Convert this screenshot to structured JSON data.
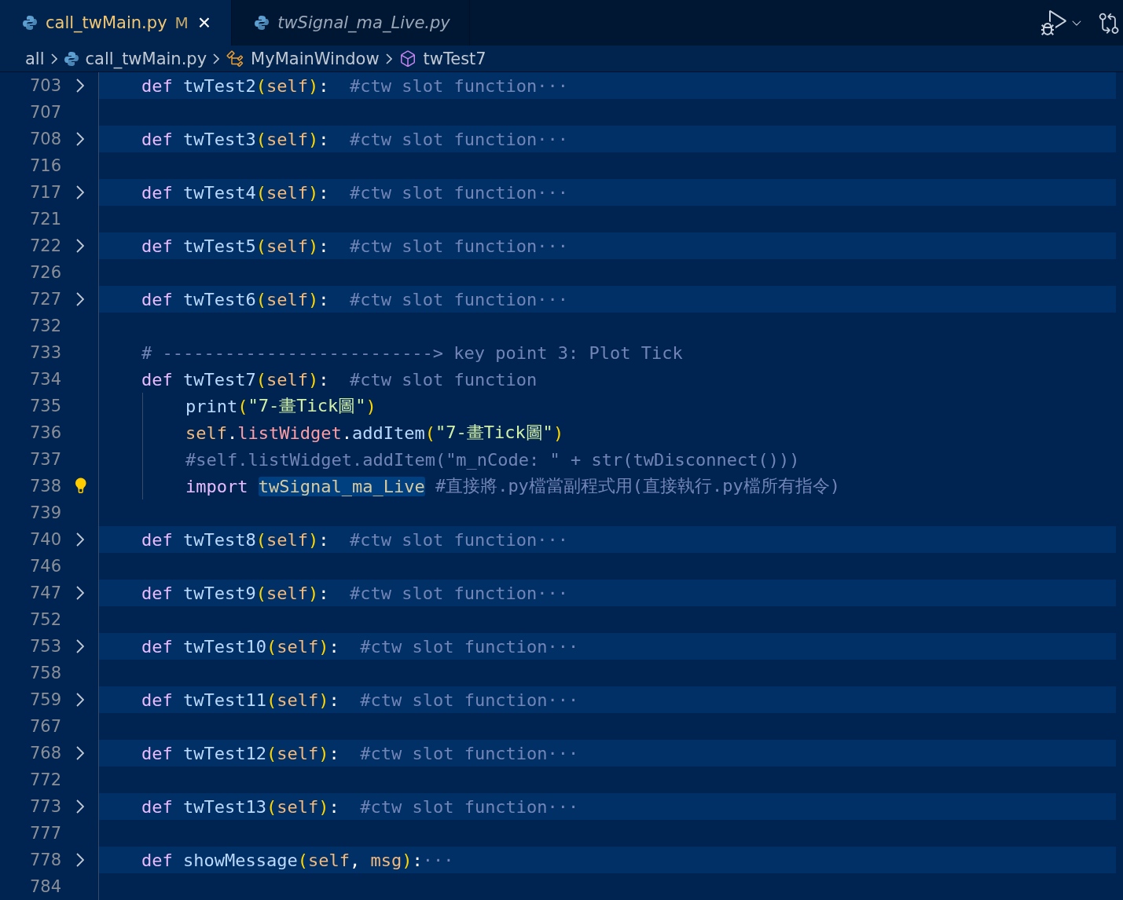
{
  "tabs": [
    {
      "label": "call_twMain.py",
      "selected": true,
      "modified": "M",
      "close": "×",
      "preview": false
    },
    {
      "label": "twSignal_ma_Live.py",
      "selected": false,
      "preview": true
    }
  ],
  "breadcrumbs": [
    {
      "kind": "folder",
      "label": "all"
    },
    {
      "kind": "file",
      "label": "call_twMain.py"
    },
    {
      "kind": "class",
      "label": "MyMainWindow"
    },
    {
      "kind": "method",
      "label": "twTest7"
    }
  ],
  "editor": {
    "lines": [
      {
        "number": "703",
        "folded": true,
        "tokens": [
          {
            "kind": "kw",
            "text": "def "
          },
          {
            "kind": "fn",
            "text": "twTest2"
          },
          {
            "kind": "paren",
            "text": "("
          },
          {
            "kind": "self",
            "text": "self"
          },
          {
            "kind": "paren",
            "text": ")"
          },
          {
            "kind": "plain",
            "text": ":  "
          },
          {
            "kind": "comment",
            "text": "#ctw slot function"
          },
          {
            "kind": "fold",
            "text": "···"
          }
        ]
      },
      {
        "number": "707",
        "folded": false
      },
      {
        "number": "708",
        "folded": true,
        "tokens": [
          {
            "kind": "kw",
            "text": "def "
          },
          {
            "kind": "fn",
            "text": "twTest3"
          },
          {
            "kind": "paren",
            "text": "("
          },
          {
            "kind": "self",
            "text": "self"
          },
          {
            "kind": "paren",
            "text": ")"
          },
          {
            "kind": "plain",
            "text": ":  "
          },
          {
            "kind": "comment",
            "text": "#ctw slot function"
          },
          {
            "kind": "fold",
            "text": "···"
          }
        ]
      },
      {
        "number": "716",
        "folded": false
      },
      {
        "number": "717",
        "folded": true,
        "tokens": [
          {
            "kind": "kw",
            "text": "def "
          },
          {
            "kind": "fn",
            "text": "twTest4"
          },
          {
            "kind": "paren",
            "text": "("
          },
          {
            "kind": "self",
            "text": "self"
          },
          {
            "kind": "paren",
            "text": ")"
          },
          {
            "kind": "plain",
            "text": ":  "
          },
          {
            "kind": "comment",
            "text": "#ctw slot function"
          },
          {
            "kind": "fold",
            "text": "···"
          }
        ]
      },
      {
        "number": "721",
        "folded": false
      },
      {
        "number": "722",
        "folded": true,
        "tokens": [
          {
            "kind": "kw",
            "text": "def "
          },
          {
            "kind": "fn",
            "text": "twTest5"
          },
          {
            "kind": "paren",
            "text": "("
          },
          {
            "kind": "self",
            "text": "self"
          },
          {
            "kind": "paren",
            "text": ")"
          },
          {
            "kind": "plain",
            "text": ":  "
          },
          {
            "kind": "comment",
            "text": "#ctw slot function"
          },
          {
            "kind": "fold",
            "text": "···"
          }
        ]
      },
      {
        "number": "726",
        "folded": false
      },
      {
        "number": "727",
        "folded": true,
        "tokens": [
          {
            "kind": "kw",
            "text": "def "
          },
          {
            "kind": "fn",
            "text": "twTest6"
          },
          {
            "kind": "paren",
            "text": "("
          },
          {
            "kind": "self",
            "text": "self"
          },
          {
            "kind": "paren",
            "text": ")"
          },
          {
            "kind": "plain",
            "text": ":  "
          },
          {
            "kind": "comment",
            "text": "#ctw slot function"
          },
          {
            "kind": "fold",
            "text": "···"
          }
        ]
      },
      {
        "number": "732",
        "folded": false
      },
      {
        "number": "733",
        "folded": false,
        "tokens": [
          {
            "kind": "comment",
            "text": "# --------------------------> key point 3: Plot Tick"
          }
        ]
      },
      {
        "number": "734",
        "folded": false,
        "tokens": [
          {
            "kind": "kw",
            "text": "def "
          },
          {
            "kind": "fn",
            "text": "twTest7"
          },
          {
            "kind": "paren",
            "text": "("
          },
          {
            "kind": "self",
            "text": "self"
          },
          {
            "kind": "paren",
            "text": ")"
          },
          {
            "kind": "plain",
            "text": ":  "
          },
          {
            "kind": "comment",
            "text": "#ctw slot function"
          }
        ]
      },
      {
        "number": "735",
        "folded": false,
        "body": true,
        "tokens": [
          {
            "kind": "fn",
            "text": "print"
          },
          {
            "kind": "paren",
            "text": "("
          },
          {
            "kind": "string",
            "text": "\"7-畫Tick圖\""
          },
          {
            "kind": "paren",
            "text": ")"
          }
        ]
      },
      {
        "number": "736",
        "folded": false,
        "body": true,
        "tokens": [
          {
            "kind": "self",
            "text": "self"
          },
          {
            "kind": "plain",
            "text": "."
          },
          {
            "kind": "attr",
            "text": "listWidget"
          },
          {
            "kind": "plain",
            "text": "."
          },
          {
            "kind": "fn",
            "text": "addItem"
          },
          {
            "kind": "paren",
            "text": "("
          },
          {
            "kind": "string",
            "text": "\"7-畫Tick圖\""
          },
          {
            "kind": "paren",
            "text": ")"
          }
        ]
      },
      {
        "number": "737",
        "folded": false,
        "body": true,
        "tokens": [
          {
            "kind": "comment",
            "text": "#self.listWidget.addItem(\"m_nCode: \" + str(twDisconnect()))"
          }
        ]
      },
      {
        "number": "738",
        "folded": false,
        "body": true,
        "lightbulb": true,
        "tokens": [
          {
            "kind": "kw",
            "text": "import "
          },
          {
            "kind": "module",
            "text": "twSignal_ma_Live",
            "highlighted": true
          },
          {
            "kind": "comment",
            "text": " #直接將.py檔當副程式用(直接執行.py檔所有指令)"
          }
        ]
      },
      {
        "number": "739",
        "folded": false
      },
      {
        "number": "740",
        "folded": true,
        "tokens": [
          {
            "kind": "kw",
            "text": "def "
          },
          {
            "kind": "fn",
            "text": "twTest8"
          },
          {
            "kind": "paren",
            "text": "("
          },
          {
            "kind": "self",
            "text": "self"
          },
          {
            "kind": "paren",
            "text": ")"
          },
          {
            "kind": "plain",
            "text": ":  "
          },
          {
            "kind": "comment",
            "text": "#ctw slot function"
          },
          {
            "kind": "fold",
            "text": "···"
          }
        ]
      },
      {
        "number": "746",
        "folded": false
      },
      {
        "number": "747",
        "folded": true,
        "tokens": [
          {
            "kind": "kw",
            "text": "def "
          },
          {
            "kind": "fn",
            "text": "twTest9"
          },
          {
            "kind": "paren",
            "text": "("
          },
          {
            "kind": "self",
            "text": "self"
          },
          {
            "kind": "paren",
            "text": ")"
          },
          {
            "kind": "plain",
            "text": ":  "
          },
          {
            "kind": "comment",
            "text": "#ctw slot function"
          },
          {
            "kind": "fold",
            "text": "···"
          }
        ]
      },
      {
        "number": "752",
        "folded": false
      },
      {
        "number": "753",
        "folded": true,
        "tokens": [
          {
            "kind": "kw",
            "text": "def "
          },
          {
            "kind": "fn",
            "text": "twTest10"
          },
          {
            "kind": "paren",
            "text": "("
          },
          {
            "kind": "self",
            "text": "self"
          },
          {
            "kind": "paren",
            "text": ")"
          },
          {
            "kind": "plain",
            "text": ":  "
          },
          {
            "kind": "comment",
            "text": "#ctw slot function"
          },
          {
            "kind": "fold",
            "text": "···"
          }
        ]
      },
      {
        "number": "758",
        "folded": false
      },
      {
        "number": "759",
        "folded": true,
        "tokens": [
          {
            "kind": "kw",
            "text": "def "
          },
          {
            "kind": "fn",
            "text": "twTest11"
          },
          {
            "kind": "paren",
            "text": "("
          },
          {
            "kind": "self",
            "text": "self"
          },
          {
            "kind": "paren",
            "text": ")"
          },
          {
            "kind": "plain",
            "text": ":  "
          },
          {
            "kind": "comment",
            "text": "#ctw slot function"
          },
          {
            "kind": "fold",
            "text": "···"
          }
        ]
      },
      {
        "number": "767",
        "folded": false
      },
      {
        "number": "768",
        "folded": true,
        "tokens": [
          {
            "kind": "kw",
            "text": "def "
          },
          {
            "kind": "fn",
            "text": "twTest12"
          },
          {
            "kind": "paren",
            "text": "("
          },
          {
            "kind": "self",
            "text": "self"
          },
          {
            "kind": "paren",
            "text": ")"
          },
          {
            "kind": "plain",
            "text": ":  "
          },
          {
            "kind": "comment",
            "text": "#ctw slot function"
          },
          {
            "kind": "fold",
            "text": "···"
          }
        ]
      },
      {
        "number": "772",
        "folded": false
      },
      {
        "number": "773",
        "folded": true,
        "tokens": [
          {
            "kind": "kw",
            "text": "def "
          },
          {
            "kind": "fn",
            "text": "twTest13"
          },
          {
            "kind": "paren",
            "text": "("
          },
          {
            "kind": "self",
            "text": "self"
          },
          {
            "kind": "paren",
            "text": ")"
          },
          {
            "kind": "plain",
            "text": ":  "
          },
          {
            "kind": "comment",
            "text": "#ctw slot function"
          },
          {
            "kind": "fold",
            "text": "···"
          }
        ]
      },
      {
        "number": "777",
        "folded": false
      },
      {
        "number": "778",
        "folded": true,
        "tokens": [
          {
            "kind": "kw",
            "text": "def "
          },
          {
            "kind": "fn",
            "text": "showMessage"
          },
          {
            "kind": "paren",
            "text": "("
          },
          {
            "kind": "self",
            "text": "self"
          },
          {
            "kind": "plain",
            "text": ", "
          },
          {
            "kind": "self",
            "text": "msg"
          },
          {
            "kind": "paren",
            "text": ")"
          },
          {
            "kind": "plain",
            "text": ":"
          },
          {
            "kind": "fold",
            "text": "···"
          }
        ]
      },
      {
        "number": "784",
        "folded": false
      }
    ]
  }
}
